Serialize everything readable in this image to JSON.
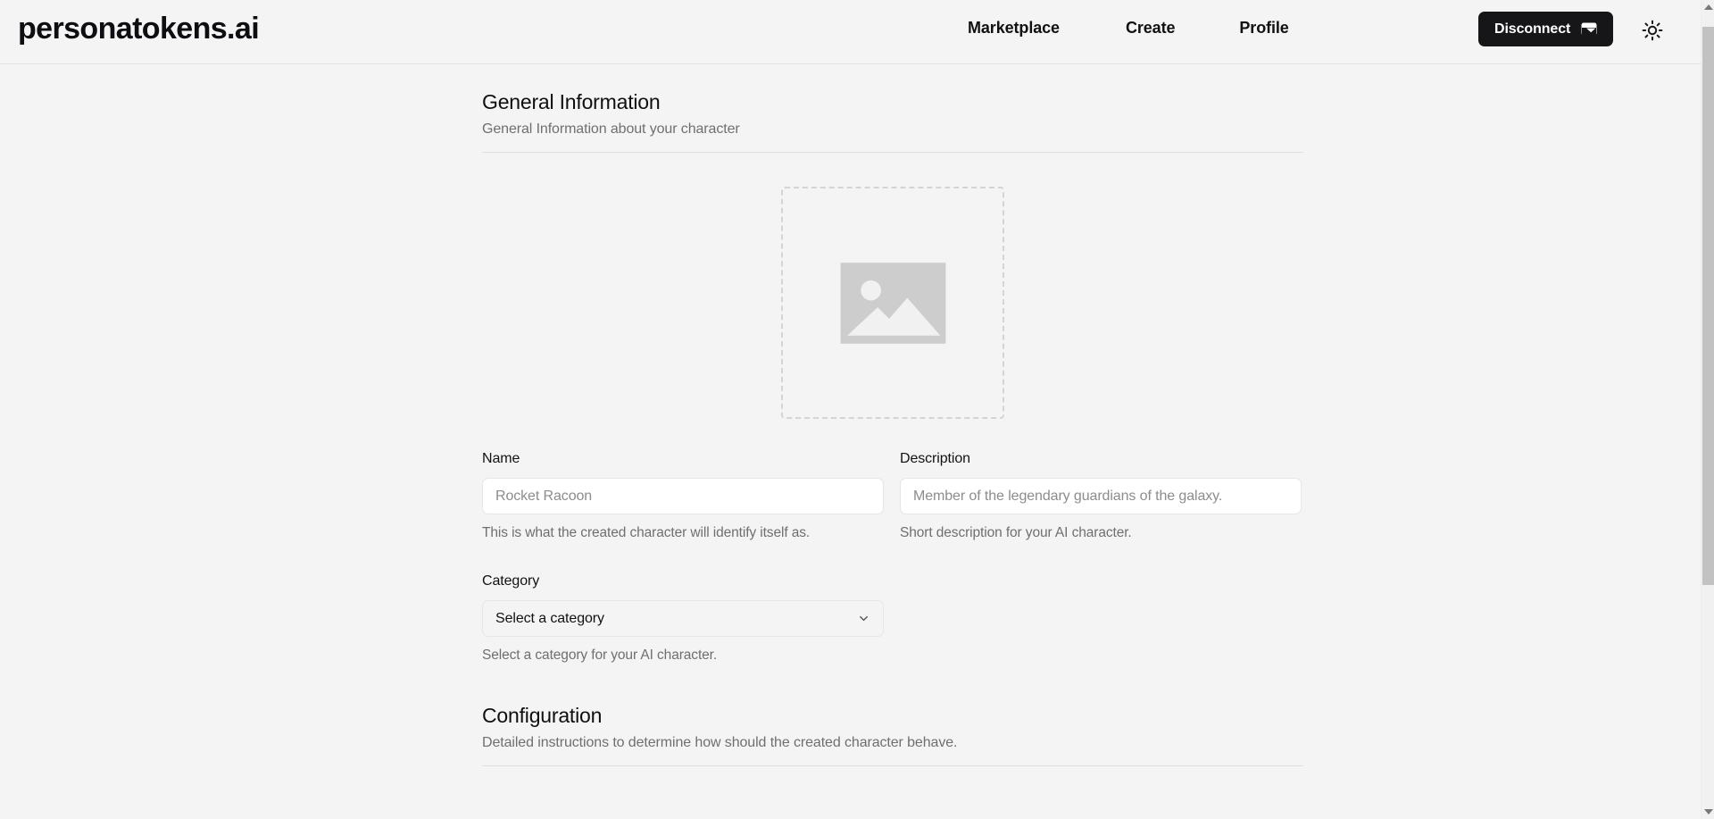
{
  "header": {
    "brand": "personatokens.ai",
    "nav": [
      {
        "label": "Marketplace",
        "name": "nav-marketplace"
      },
      {
        "label": "Create",
        "name": "nav-create"
      },
      {
        "label": "Profile",
        "name": "nav-profile"
      }
    ],
    "disconnect_label": "Disconnect",
    "disconnect_icon": "wallet-icon",
    "theme_toggle_icon": "sun-icon",
    "accent_dark": "#161618",
    "page_background": "#f4f4f4"
  },
  "general_information": {
    "title": "General Information",
    "subtitle": "General Information about your character",
    "upload": {
      "icon": "image-placeholder-icon"
    },
    "name_field": {
      "label": "Name",
      "value": "",
      "placeholder": "Rocket Racoon",
      "help": "This is what the created character will identify itself as."
    },
    "description_field": {
      "label": "Description",
      "value": "",
      "placeholder": "Member of the legendary guardians of the galaxy.",
      "help": "Short description for your AI character."
    },
    "category_field": {
      "label": "Category",
      "selected": "Select a category",
      "help": "Select a category for your AI character.",
      "chevron_icon": "chevron-down-icon"
    }
  },
  "configuration": {
    "title": "Configuration",
    "subtitle": "Detailed instructions to determine how should the created character behave."
  }
}
